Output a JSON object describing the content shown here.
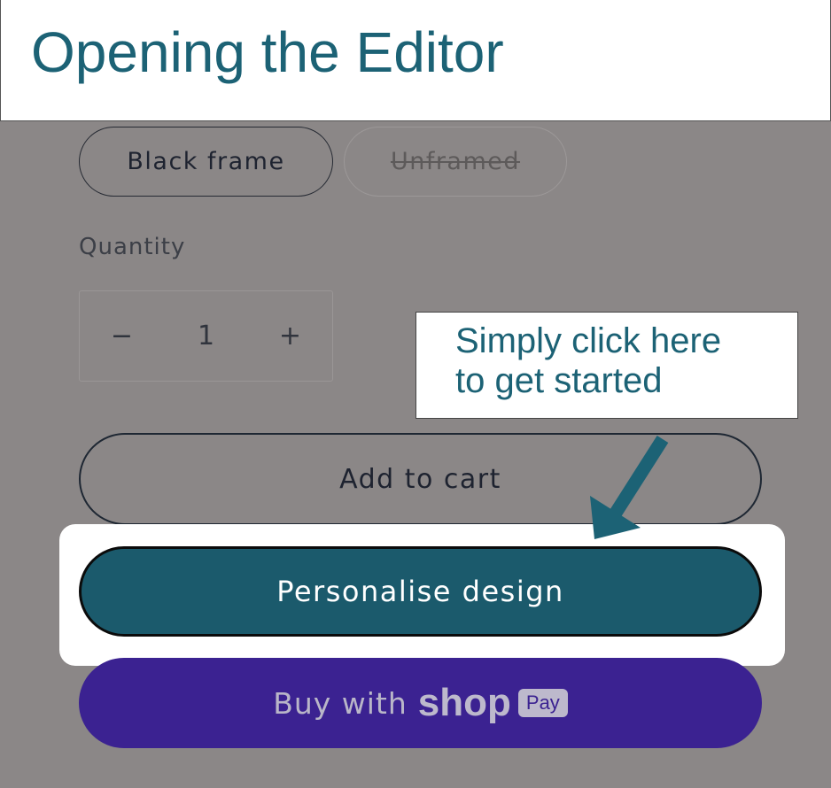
{
  "header": {
    "title": "Opening the Editor"
  },
  "variants": {
    "selected": "Black frame",
    "unavailable": "Unframed"
  },
  "quantity": {
    "label": "Quantity",
    "value": "1",
    "decrement": "−",
    "increment": "+"
  },
  "callout": {
    "line1": "Simply click here",
    "line2": "to get started"
  },
  "buttons": {
    "add_to_cart": "Add to cart",
    "personalise": "Personalise design",
    "buy_with": "Buy with",
    "shop": "shop",
    "pay": "Pay"
  },
  "colors": {
    "accent": "#1c6275",
    "personalise_bg": "#1b5a6c",
    "shop_pay_bg": "#3b2291",
    "overlay": "#8b8787"
  },
  "icons": {
    "arrow": "arrow-down-left-icon"
  }
}
